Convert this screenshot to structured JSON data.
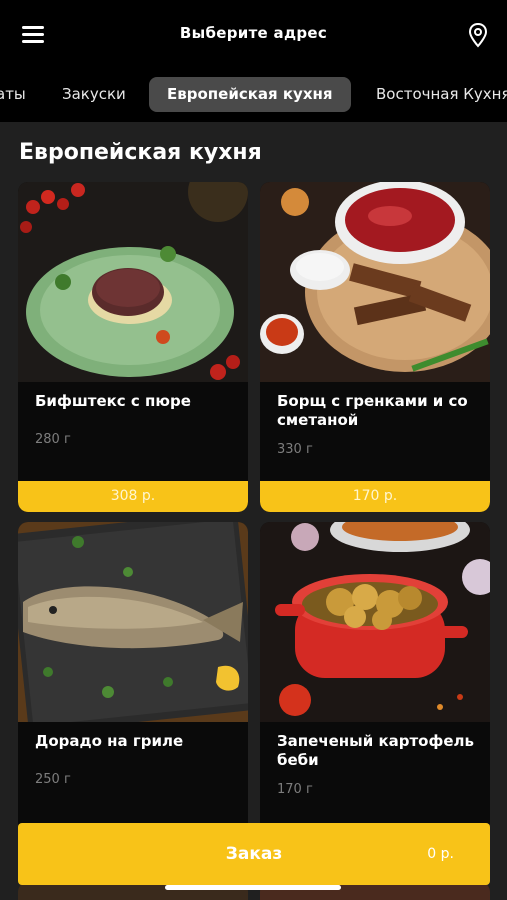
{
  "header": {
    "title": "Выберите адрес",
    "menu_icon": "hamburger-icon",
    "location_icon": "location-pin-icon"
  },
  "tabs": [
    {
      "label": "аты",
      "active": false
    },
    {
      "label": "Закуски",
      "active": false
    },
    {
      "label": "Европейская кухня",
      "active": true
    },
    {
      "label": "Восточная Кухня",
      "active": false
    }
  ],
  "section": {
    "title": "Европейская кухня"
  },
  "products": [
    {
      "name": "Бифштекс с пюре",
      "weight": "280 г",
      "price": "308 р."
    },
    {
      "name": "Борщ с гренками и со сметаной",
      "weight": "330 г",
      "price": "170 р."
    },
    {
      "name": "Дорадо на гриле",
      "weight": "250 г",
      "price": ""
    },
    {
      "name": "Запеченый картофель беби",
      "weight": "170 г",
      "price": ""
    }
  ],
  "order": {
    "label": "Заказ",
    "total": "0 р."
  },
  "colors": {
    "accent": "#f8c318",
    "background": "#202020",
    "header": "#000000",
    "card": "#0a0a0a"
  }
}
